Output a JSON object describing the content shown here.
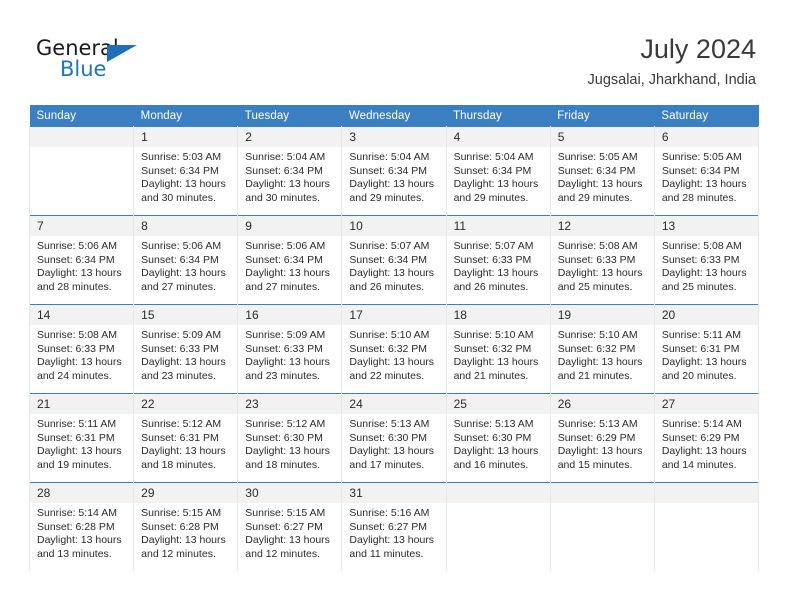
{
  "brand": {
    "name_primary": "General",
    "name_secondary": "Blue",
    "triangle_icon": "triangle-icon",
    "accent_color": "#2175bd"
  },
  "header": {
    "title": "July 2024",
    "location": "Jugsalai, Jharkhand, India"
  },
  "theme": {
    "header_row_bg": "#3a7fc1",
    "header_row_text": "#ffffff",
    "daynum_bg": "#f2f2f2",
    "cell_bg": "#ffffff",
    "grid_line": "#e8e8e8",
    "week_separator": "#3a7fc1"
  },
  "weekday_headers": [
    "Sunday",
    "Monday",
    "Tuesday",
    "Wednesday",
    "Thursday",
    "Friday",
    "Saturday"
  ],
  "labels": {
    "sunrise_prefix": "Sunrise:",
    "sunset_prefix": "Sunset:",
    "daylight_prefix": "Daylight:"
  },
  "weeks": [
    [
      {
        "day": "",
        "blank": true
      },
      {
        "day": "1",
        "sunrise": "Sunrise: 5:03 AM",
        "sunset": "Sunset: 6:34 PM",
        "daylight_line1": "Daylight: 13 hours",
        "daylight_line2": "and 30 minutes."
      },
      {
        "day": "2",
        "sunrise": "Sunrise: 5:04 AM",
        "sunset": "Sunset: 6:34 PM",
        "daylight_line1": "Daylight: 13 hours",
        "daylight_line2": "and 30 minutes."
      },
      {
        "day": "3",
        "sunrise": "Sunrise: 5:04 AM",
        "sunset": "Sunset: 6:34 PM",
        "daylight_line1": "Daylight: 13 hours",
        "daylight_line2": "and 29 minutes."
      },
      {
        "day": "4",
        "sunrise": "Sunrise: 5:04 AM",
        "sunset": "Sunset: 6:34 PM",
        "daylight_line1": "Daylight: 13 hours",
        "daylight_line2": "and 29 minutes."
      },
      {
        "day": "5",
        "sunrise": "Sunrise: 5:05 AM",
        "sunset": "Sunset: 6:34 PM",
        "daylight_line1": "Daylight: 13 hours",
        "daylight_line2": "and 29 minutes."
      },
      {
        "day": "6",
        "sunrise": "Sunrise: 5:05 AM",
        "sunset": "Sunset: 6:34 PM",
        "daylight_line1": "Daylight: 13 hours",
        "daylight_line2": "and 28 minutes."
      }
    ],
    [
      {
        "day": "7",
        "sunrise": "Sunrise: 5:06 AM",
        "sunset": "Sunset: 6:34 PM",
        "daylight_line1": "Daylight: 13 hours",
        "daylight_line2": "and 28 minutes."
      },
      {
        "day": "8",
        "sunrise": "Sunrise: 5:06 AM",
        "sunset": "Sunset: 6:34 PM",
        "daylight_line1": "Daylight: 13 hours",
        "daylight_line2": "and 27 minutes."
      },
      {
        "day": "9",
        "sunrise": "Sunrise: 5:06 AM",
        "sunset": "Sunset: 6:34 PM",
        "daylight_line1": "Daylight: 13 hours",
        "daylight_line2": "and 27 minutes."
      },
      {
        "day": "10",
        "sunrise": "Sunrise: 5:07 AM",
        "sunset": "Sunset: 6:34 PM",
        "daylight_line1": "Daylight: 13 hours",
        "daylight_line2": "and 26 minutes."
      },
      {
        "day": "11",
        "sunrise": "Sunrise: 5:07 AM",
        "sunset": "Sunset: 6:33 PM",
        "daylight_line1": "Daylight: 13 hours",
        "daylight_line2": "and 26 minutes."
      },
      {
        "day": "12",
        "sunrise": "Sunrise: 5:08 AM",
        "sunset": "Sunset: 6:33 PM",
        "daylight_line1": "Daylight: 13 hours",
        "daylight_line2": "and 25 minutes."
      },
      {
        "day": "13",
        "sunrise": "Sunrise: 5:08 AM",
        "sunset": "Sunset: 6:33 PM",
        "daylight_line1": "Daylight: 13 hours",
        "daylight_line2": "and 25 minutes."
      }
    ],
    [
      {
        "day": "14",
        "sunrise": "Sunrise: 5:08 AM",
        "sunset": "Sunset: 6:33 PM",
        "daylight_line1": "Daylight: 13 hours",
        "daylight_line2": "and 24 minutes."
      },
      {
        "day": "15",
        "sunrise": "Sunrise: 5:09 AM",
        "sunset": "Sunset: 6:33 PM",
        "daylight_line1": "Daylight: 13 hours",
        "daylight_line2": "and 23 minutes."
      },
      {
        "day": "16",
        "sunrise": "Sunrise: 5:09 AM",
        "sunset": "Sunset: 6:33 PM",
        "daylight_line1": "Daylight: 13 hours",
        "daylight_line2": "and 23 minutes."
      },
      {
        "day": "17",
        "sunrise": "Sunrise: 5:10 AM",
        "sunset": "Sunset: 6:32 PM",
        "daylight_line1": "Daylight: 13 hours",
        "daylight_line2": "and 22 minutes."
      },
      {
        "day": "18",
        "sunrise": "Sunrise: 5:10 AM",
        "sunset": "Sunset: 6:32 PM",
        "daylight_line1": "Daylight: 13 hours",
        "daylight_line2": "and 21 minutes."
      },
      {
        "day": "19",
        "sunrise": "Sunrise: 5:10 AM",
        "sunset": "Sunset: 6:32 PM",
        "daylight_line1": "Daylight: 13 hours",
        "daylight_line2": "and 21 minutes."
      },
      {
        "day": "20",
        "sunrise": "Sunrise: 5:11 AM",
        "sunset": "Sunset: 6:31 PM",
        "daylight_line1": "Daylight: 13 hours",
        "daylight_line2": "and 20 minutes."
      }
    ],
    [
      {
        "day": "21",
        "sunrise": "Sunrise: 5:11 AM",
        "sunset": "Sunset: 6:31 PM",
        "daylight_line1": "Daylight: 13 hours",
        "daylight_line2": "and 19 minutes."
      },
      {
        "day": "22",
        "sunrise": "Sunrise: 5:12 AM",
        "sunset": "Sunset: 6:31 PM",
        "daylight_line1": "Daylight: 13 hours",
        "daylight_line2": "and 18 minutes."
      },
      {
        "day": "23",
        "sunrise": "Sunrise: 5:12 AM",
        "sunset": "Sunset: 6:30 PM",
        "daylight_line1": "Daylight: 13 hours",
        "daylight_line2": "and 18 minutes."
      },
      {
        "day": "24",
        "sunrise": "Sunrise: 5:13 AM",
        "sunset": "Sunset: 6:30 PM",
        "daylight_line1": "Daylight: 13 hours",
        "daylight_line2": "and 17 minutes."
      },
      {
        "day": "25",
        "sunrise": "Sunrise: 5:13 AM",
        "sunset": "Sunset: 6:30 PM",
        "daylight_line1": "Daylight: 13 hours",
        "daylight_line2": "and 16 minutes."
      },
      {
        "day": "26",
        "sunrise": "Sunrise: 5:13 AM",
        "sunset": "Sunset: 6:29 PM",
        "daylight_line1": "Daylight: 13 hours",
        "daylight_line2": "and 15 minutes."
      },
      {
        "day": "27",
        "sunrise": "Sunrise: 5:14 AM",
        "sunset": "Sunset: 6:29 PM",
        "daylight_line1": "Daylight: 13 hours",
        "daylight_line2": "and 14 minutes."
      }
    ],
    [
      {
        "day": "28",
        "sunrise": "Sunrise: 5:14 AM",
        "sunset": "Sunset: 6:28 PM",
        "daylight_line1": "Daylight: 13 hours",
        "daylight_line2": "and 13 minutes."
      },
      {
        "day": "29",
        "sunrise": "Sunrise: 5:15 AM",
        "sunset": "Sunset: 6:28 PM",
        "daylight_line1": "Daylight: 13 hours",
        "daylight_line2": "and 12 minutes."
      },
      {
        "day": "30",
        "sunrise": "Sunrise: 5:15 AM",
        "sunset": "Sunset: 6:27 PM",
        "daylight_line1": "Daylight: 13 hours",
        "daylight_line2": "and 12 minutes."
      },
      {
        "day": "31",
        "sunrise": "Sunrise: 5:16 AM",
        "sunset": "Sunset: 6:27 PM",
        "daylight_line1": "Daylight: 13 hours",
        "daylight_line2": "and 11 minutes."
      },
      {
        "day": "",
        "blank": true
      },
      {
        "day": "",
        "blank": true
      },
      {
        "day": "",
        "blank": true
      }
    ]
  ]
}
